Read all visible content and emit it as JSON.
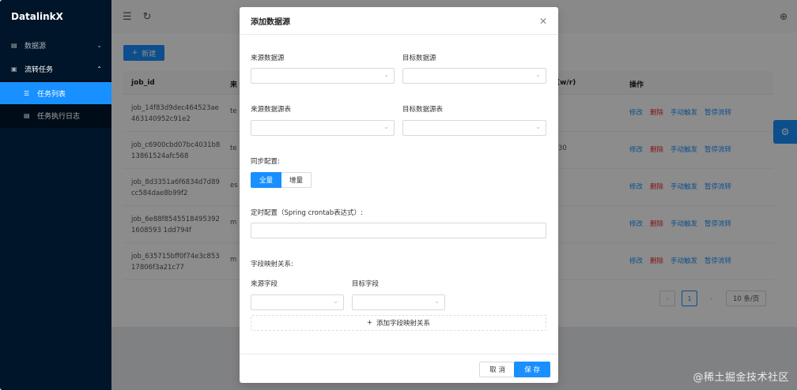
{
  "sidebar": {
    "brand": "DatalinkX",
    "items": [
      {
        "label": "数据源",
        "icon": "database-icon"
      },
      {
        "label": "流转任务",
        "icon": "task-icon"
      }
    ],
    "sub_items": [
      {
        "label": "任务列表",
        "icon": "list-icon"
      },
      {
        "label": "任务执行日志",
        "icon": "log-icon"
      }
    ]
  },
  "content": {
    "new_button": "新建",
    "columns": {
      "id": "job_id",
      "src": "来",
      "wr": "(w/r)",
      "ops": "操作"
    },
    "rows": [
      {
        "id": "job_14f83d9dec464523ae463140952c91e2",
        "src": "te",
        "wr": ""
      },
      {
        "id": "job_c6900cbd07bc4031b813861524afc568",
        "src": "te",
        "wr": "30"
      },
      {
        "id": "job_8d3351a6f6834d7d89cc584dae8b99f2",
        "src": "es",
        "wr": ""
      },
      {
        "id": "job_6e88f85455184953921608593 1dd794f",
        "src": "m",
        "wr": ""
      },
      {
        "id": "job_635715bff0f74e3c85317806f3a21c77",
        "src": "m",
        "wr": ""
      }
    ],
    "actions": {
      "edit": "修改",
      "delete": "删除",
      "trigger": "手动触发",
      "pause": "暂停流转"
    },
    "pager": {
      "current": "1",
      "size": "10 条/页"
    }
  },
  "modal": {
    "title": "添加数据源",
    "source_ds_label": "来源数据源",
    "target_ds_label": "目标数据源",
    "source_table_label": "来源数据源表",
    "target_table_label": "目标数据源表",
    "sync_label": "同步配置:",
    "sync_options": [
      "全量",
      "增量"
    ],
    "cron_label": "定时配置（Spring crontab表达式）:",
    "mapping_label": "字段映射关系:",
    "source_field_label": "来源字段",
    "target_field_label": "目标字段",
    "add_mapping": "添加字段映射关系",
    "cancel": "取 消",
    "save": "保 存"
  },
  "watermark": "@稀土掘金技术社区"
}
